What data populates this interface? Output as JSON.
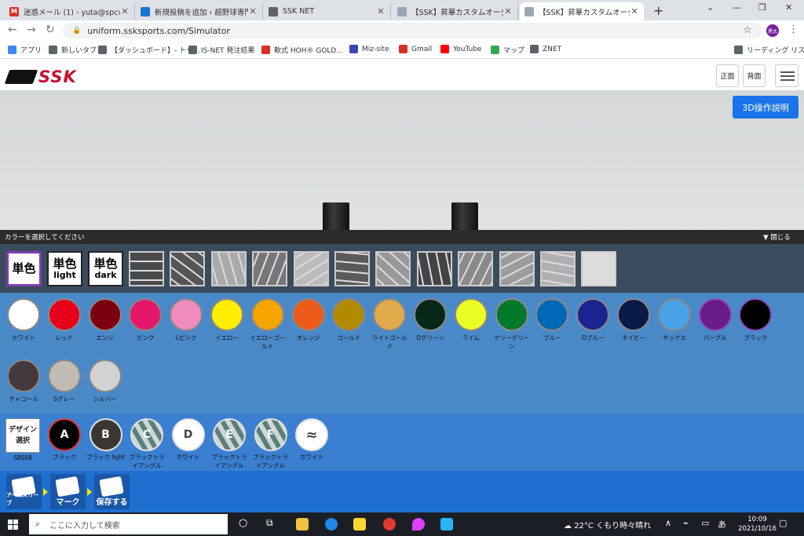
{
  "tabs": [
    {
      "title": "迷惑メール (1) - yuta@spcv.jp",
      "icon": "gmail-icon",
      "color": "#d93025",
      "glyph": "M"
    },
    {
      "title": "新規投稿を追加 ‹ 超野球専門",
      "icon": "wordpress-icon",
      "color": "#1976d2",
      "glyph": ""
    },
    {
      "title": "SSK NET",
      "icon": "globe-icon",
      "color": "#5f6368",
      "glyph": ""
    },
    {
      "title": "【SSK】昇華カスタムオーダー シミュ",
      "icon": "page-icon",
      "color": "#9aa7b7",
      "glyph": ""
    },
    {
      "title": "【SSK】昇華カスタムオーダー シミュ",
      "icon": "page-icon",
      "color": "#9aa7b7",
      "glyph": ""
    }
  ],
  "address": {
    "url": "uniform.ssksports.com/Simulator"
  },
  "profile": {
    "initials": "勇太"
  },
  "bookmarks": [
    {
      "label": "アプリ",
      "color": "#4285f4"
    },
    {
      "label": "新しいタブ",
      "color": "#5f6368"
    },
    {
      "label": "【ダッシュボード】- トッ...",
      "color": "#5f6368"
    },
    {
      "label": "IS-NET 発注結果",
      "color": "#5f6368"
    },
    {
      "label": "軟式 HOH® GOLD...",
      "color": "#d93025"
    },
    {
      "label": "Miz-site",
      "color": "#3949ab"
    },
    {
      "label": "Gmail",
      "color": "#d93025"
    },
    {
      "label": "YouTube",
      "color": "#ff0000"
    },
    {
      "label": "マップ",
      "color": "#34a853"
    },
    {
      "label": "ZNET",
      "color": "#5f6368"
    }
  ],
  "reading_list": "リーディング リスト",
  "site": {
    "logo": "SSK",
    "front": "正面",
    "back": "背面",
    "help3d": "3D操作説明"
  },
  "selector": {
    "title": "カラーを選択してください",
    "close": "閉じる"
  },
  "patterns": [
    {
      "a": "単色",
      "b": ""
    },
    {
      "a": "単色",
      "b": "light"
    },
    {
      "a": "単色",
      "b": "dark"
    }
  ],
  "textures": [
    {
      "name": "camo-dark",
      "bg": "#4a4a4a"
    },
    {
      "name": "digital-camo",
      "bg": "#555"
    },
    {
      "name": "triangle",
      "bg": "#aaa"
    },
    {
      "name": "shatter",
      "bg": "#777"
    },
    {
      "name": "stripe",
      "bg": "#bbb"
    },
    {
      "name": "starry",
      "bg": "#5a5a5a"
    },
    {
      "name": "leaf",
      "bg": "#999"
    },
    {
      "name": "mesh",
      "bg": "#444"
    },
    {
      "name": "noise",
      "bg": "#8a8a8a"
    },
    {
      "name": "camo-light",
      "bg": "#9c9c9c"
    },
    {
      "name": "wood",
      "bg": "#b0b0b0"
    },
    {
      "name": "marble",
      "bg": "#dcdcdc"
    }
  ],
  "colors": [
    {
      "name": "ホワイト",
      "hex": "#ffffff"
    },
    {
      "name": "レッド",
      "hex": "#e6001a"
    },
    {
      "name": "エンジ",
      "hex": "#7d0012"
    },
    {
      "name": "ピンク",
      "hex": "#e5176b"
    },
    {
      "name": "Lピンク",
      "hex": "#ef8bbd"
    },
    {
      "name": "イエロー",
      "hex": "#ffee00"
    },
    {
      "name": "イエローゴールド",
      "hex": "#f6a400"
    },
    {
      "name": "オレンジ",
      "hex": "#ec5a1a"
    },
    {
      "name": "ゴールド",
      "hex": "#b28a00"
    },
    {
      "name": "ライトゴールド",
      "hex": "#e0a94a"
    },
    {
      "name": "Dグリーン",
      "hex": "#072818"
    },
    {
      "name": "ライム",
      "hex": "#ecff24"
    },
    {
      "name": "ケリーグリーン",
      "hex": "#007a2a"
    },
    {
      "name": "ブルー",
      "hex": "#0068b7"
    },
    {
      "name": "Dブルー",
      "hex": "#1b2390"
    },
    {
      "name": "ネイビー",
      "hex": "#0a1a46"
    },
    {
      "name": "サックス",
      "hex": "#4aa3e8"
    },
    {
      "name": "パープル",
      "hex": "#6b1c8b"
    },
    {
      "name": "ブラック",
      "hex": "#000000"
    },
    {
      "name": "チャコール",
      "hex": "#45383a"
    },
    {
      "name": "Sグレー",
      "hex": "#c1bdb4"
    },
    {
      "name": "シルバー",
      "hex": "#d2d2d2"
    }
  ],
  "design": {
    "label": "デザイン選択",
    "code": "SBS88"
  },
  "parts": [
    {
      "letter": "A",
      "label": "ブラック",
      "fill": "#000000",
      "tc": "#ffffff",
      "tri": false
    },
    {
      "letter": "B",
      "label": "ブラック light",
      "fill": "#3c3633",
      "tc": "#ffffff",
      "tri": false
    },
    {
      "letter": "C",
      "label": "ブラックトライアングル",
      "fill": "#5b7f7a",
      "tc": "#ffffff",
      "tri": true
    },
    {
      "letter": "D",
      "label": "ホワイト",
      "fill": "#ffffff",
      "tc": "#444444",
      "tri": false
    },
    {
      "letter": "E",
      "label": "ブラックトライアングル",
      "fill": "#5b7f7a",
      "tc": "#ffffff",
      "tri": true
    },
    {
      "letter": "F",
      "label": "ブラックトライアングル",
      "fill": "#5b7f7a",
      "tc": "#ffffff",
      "tri": true
    },
    {
      "letter": "",
      "label": "ホワイト",
      "fill": "#ffffff",
      "tc": "#444444",
      "tri": false
    }
  ],
  "steps": [
    {
      "label": "アームスリーブ"
    },
    {
      "label": "マーク"
    },
    {
      "label": "保存する"
    }
  ],
  "taskbar": {
    "search": "ここに入力して検索",
    "weather": "22°C くもり時々晴れ",
    "time": "10:09",
    "date": "2021/10/16",
    "ime": "あ"
  }
}
